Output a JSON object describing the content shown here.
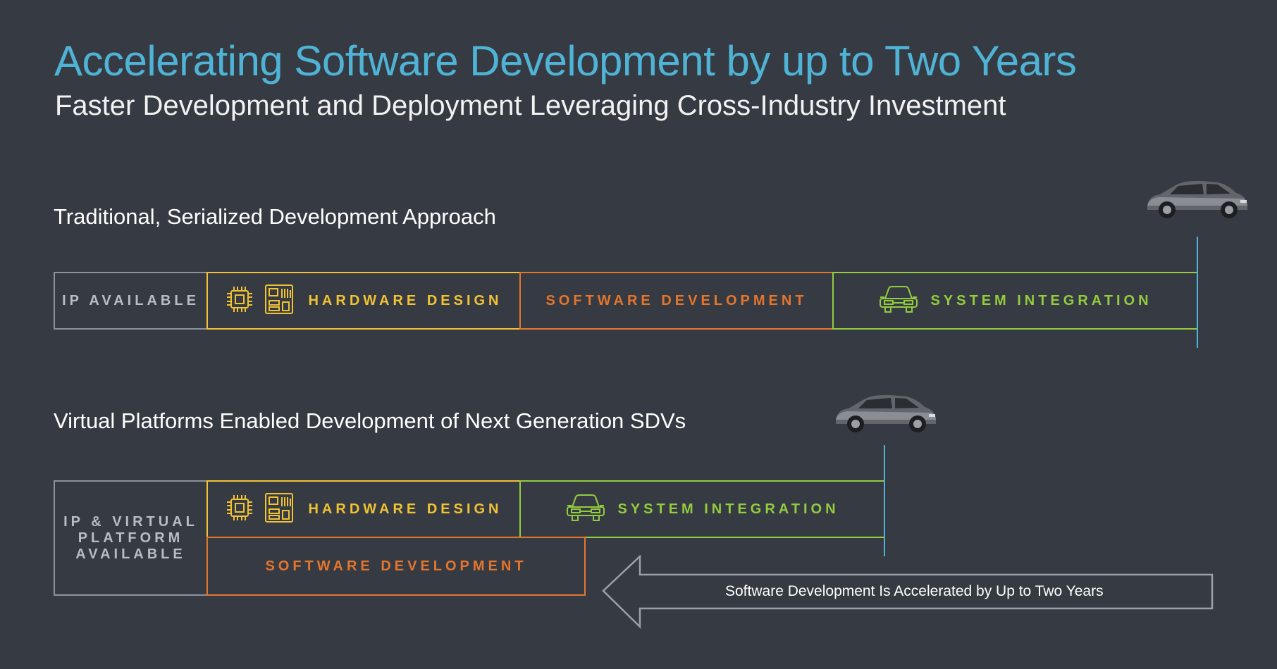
{
  "header": {
    "title": "Accelerating Software Development by up to Two Years",
    "subtitle": "Faster Development and Deployment Leveraging Cross-Industry Investment"
  },
  "traditional": {
    "heading": "Traditional, Serialized Development Approach",
    "ip_label": "IP AVAILABLE",
    "hardware_label": "HARDWARE DESIGN",
    "software_label": "SOFTWARE DEVELOPMENT",
    "integration_label": "SYSTEM INTEGRATION"
  },
  "virtual": {
    "heading": "Virtual Platforms Enabled Development of Next Generation SDVs",
    "ip_label_lines": [
      "IP & VIRTUAL",
      "PLATFORM",
      "AVAILABLE"
    ],
    "hardware_label": "HARDWARE DESIGN",
    "integration_label": "SYSTEM INTEGRATION",
    "software_label": "SOFTWARE DEVELOPMENT",
    "arrow_text": "Software Development Is Accelerated by Up to Two Years"
  },
  "colors": {
    "background": "#363b43",
    "accent_blue": "#4fb3d6",
    "hardware_yellow": "#f1c232",
    "software_orange": "#e6752c",
    "integration_green": "#93cc3d",
    "ip_gray": "#8d929a"
  },
  "icons": [
    "chip-icon",
    "circuit-board-icon",
    "car-front-icon",
    "car-image"
  ]
}
